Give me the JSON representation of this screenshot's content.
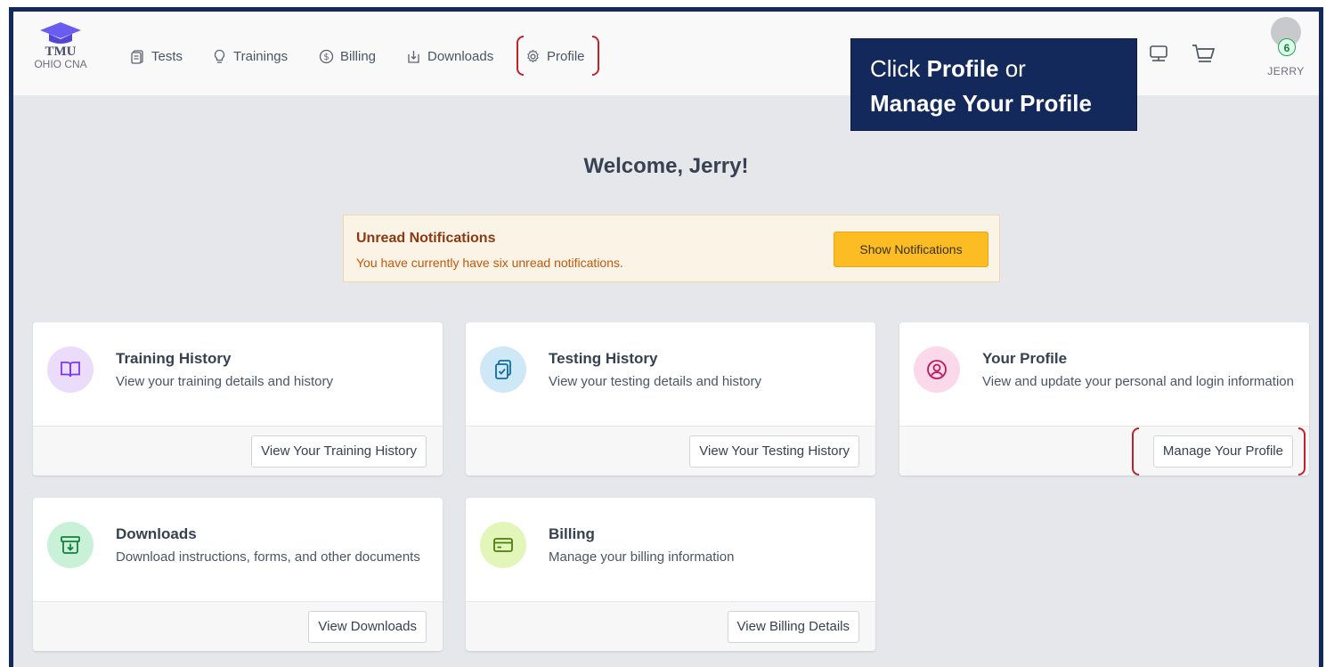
{
  "app": {
    "logo_top": "TMU",
    "logo_bottom": "OHIO CNA"
  },
  "nav": {
    "tests": "Tests",
    "trainings": "Trainings",
    "billing": "Billing",
    "downloads": "Downloads",
    "profile": "Profile"
  },
  "callout": {
    "line1_prefix": "Click ",
    "line1_bold": "Profile",
    "line1_suffix": " or",
    "line2_bold": "Manage Your Profile"
  },
  "user": {
    "badge_count": "6",
    "name": "JERRY"
  },
  "welcome": "Welcome, Jerry!",
  "notifications": {
    "title": "Unread Notifications",
    "message": "You have currently have six unread notifications.",
    "button": "Show Notifications"
  },
  "cards": [
    {
      "title": "Training History",
      "desc": "View your training details and history",
      "button": "View Your Training History",
      "icon": "book-icon",
      "icon_bg": "#ecdcfb"
    },
    {
      "title": "Testing History",
      "desc": "View your testing details and history",
      "button": "View Your Testing History",
      "icon": "clipboard-check-icon",
      "icon_bg": "#cfe8f8"
    },
    {
      "title": "Your Profile",
      "desc": "View and update your personal and login information",
      "button": "Manage Your Profile",
      "icon": "user-circle-icon",
      "icon_bg": "#fbd9ea"
    },
    {
      "title": "Downloads",
      "desc": "Download instructions, forms, and other documents",
      "button": "View Downloads",
      "icon": "archive-download-icon",
      "icon_bg": "#c9f1d7"
    },
    {
      "title": "Billing",
      "desc": "Manage your billing information",
      "button": "View Billing Details",
      "icon": "credit-card-icon",
      "icon_bg": "#e2f6b9"
    }
  ],
  "colors": {
    "frame": "#13285b",
    "highlight": "#c0222b",
    "accent_button": "#fbbd23"
  }
}
